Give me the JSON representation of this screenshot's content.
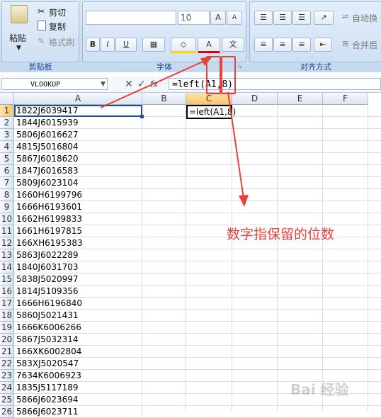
{
  "ribbon": {
    "clipboard": {
      "paste": "粘贴",
      "cut": "剪切",
      "copy": "复制",
      "format_painter": "格式刷",
      "group_label": "剪贴板"
    },
    "font": {
      "font_size": "10",
      "bold": "B",
      "italic": "I",
      "underline": "U",
      "group_label": "字体"
    },
    "alignment": {
      "wrap_text": "自动换",
      "merge": "合并后",
      "group_label": "对齐方式"
    }
  },
  "formula_bar": {
    "name_box": "VLOOKUP",
    "cancel": "✕",
    "enter": "✓",
    "fx": "fx",
    "formula": "=left(A1,8)"
  },
  "columns": [
    "A",
    "B",
    "C",
    "D",
    "E",
    "F"
  ],
  "selected_column": "C",
  "active_cell_text": "=left(A1,8)",
  "rows": [
    "1",
    "2",
    "3",
    "4",
    "5",
    "6",
    "7",
    "8",
    "9",
    "10",
    "11",
    "12",
    "13",
    "14",
    "15",
    "16",
    "17",
    "18",
    "19",
    "20",
    "21",
    "22",
    "23",
    "24",
    "25",
    "26"
  ],
  "column_a": [
    "1822J6039417",
    "1844J6015939",
    "5806J6016627",
    "4815J5016804",
    "5867J6018620",
    "1847J6016583",
    "5809J6023104",
    "1660H6199796",
    "1666H6193601",
    "1662H6199833",
    "1661H6197815",
    "166XH6195383",
    "5863J6022289",
    "1840J6031703",
    "5838J5020997",
    "1814J5109356",
    "1666H6196840",
    "5860J5021431",
    "1666K6006266",
    "5867J5032314",
    "166XK6002804",
    "583XJ5020547",
    "7634K6006923",
    "1835J5117189",
    "5866J6023694",
    "5866J6023711"
  ],
  "annotation": "数字指保留的位数",
  "watermark": "Bai 经验"
}
